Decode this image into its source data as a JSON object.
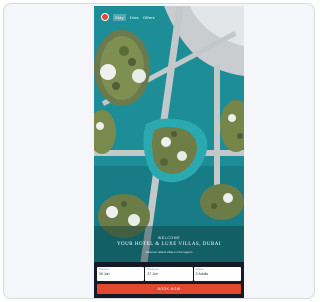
{
  "nav": {
    "links": [
      "Stay",
      "Dine",
      "Offers"
    ]
  },
  "hero": {
    "eyebrow": "WELCOME",
    "headline": "YOUR HOTEL & LUXE VILLAS, DUBAI",
    "subtext": "Discover island villas on the lagoon"
  },
  "booking": {
    "checkin_label": "Check-in",
    "checkin_value": "26 Jun",
    "checkout_label": "Check-out",
    "checkout_value": "27 Jun",
    "guests_label": "Guests",
    "guests_value": "2 Adults",
    "button_label": "BOOK NOW"
  },
  "colors": {
    "water": "#1d8e98",
    "accent": "#e0482f",
    "booking_bar": "#151b26"
  }
}
